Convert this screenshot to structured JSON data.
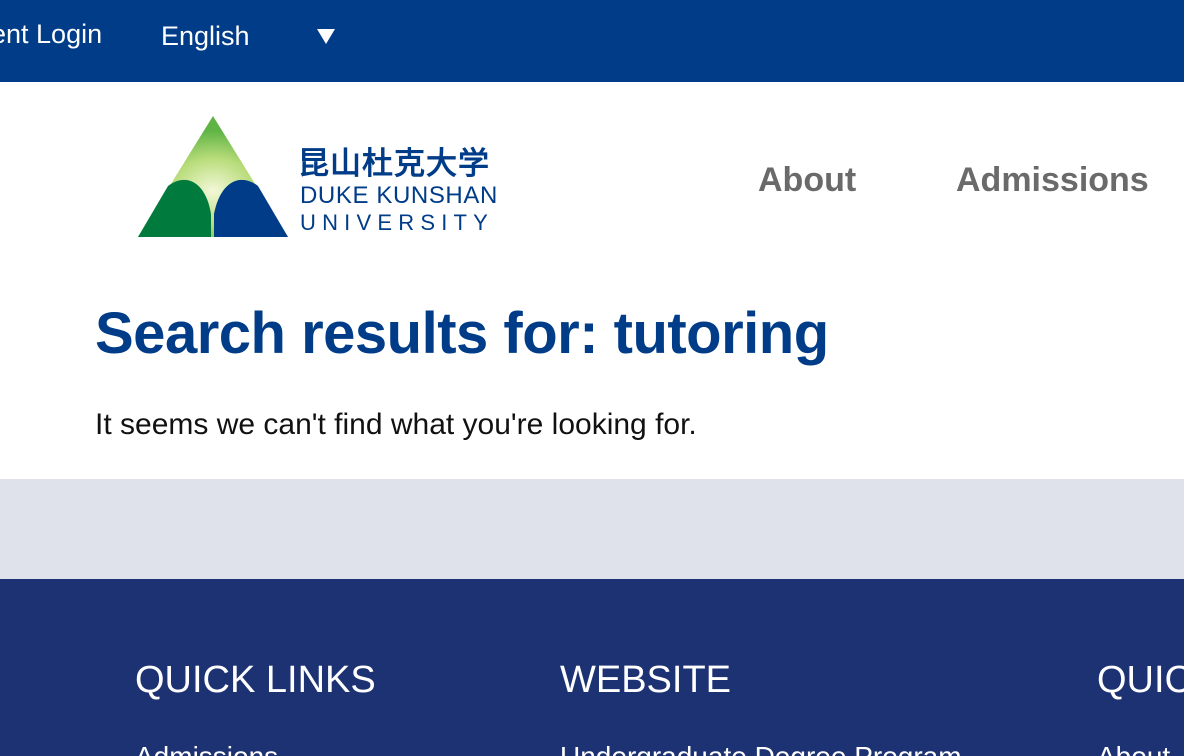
{
  "topbar": {
    "login_label": "ent Login",
    "language": "English",
    "language_caret_icon": "triangle-down-icon"
  },
  "logo": {
    "chinese": "昆山杜克大学",
    "line1": "DUKE KUNSHAN",
    "line2": "UNIVERSITY",
    "colors": {
      "green_dark": "#007a3d",
      "green_light": "#6fbf4a",
      "blue": "#003c87"
    }
  },
  "nav": {
    "items": [
      "About",
      "Admissions"
    ]
  },
  "main": {
    "title": "Search results for: tutoring",
    "message": "It seems we can't find what you're looking for."
  },
  "footer": {
    "columns": [
      {
        "title": "QUICK LINKS",
        "first_link": "Admissions"
      },
      {
        "title": "WEBSITE",
        "first_link": "Undergraduate Degree Program"
      },
      {
        "title": "QUIC",
        "first_link": "About"
      }
    ]
  },
  "colors": {
    "primary": "#003c87",
    "footer_bg": "#1d3273",
    "band_bg": "#dfe2ea",
    "nav_text": "#6a6a6a"
  }
}
